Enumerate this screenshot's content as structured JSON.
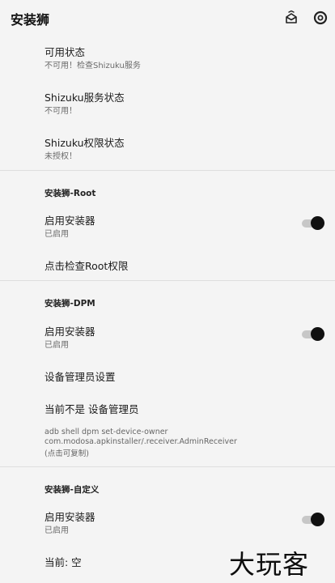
{
  "app": {
    "title": "安装狮"
  },
  "appbar": {
    "icons": [
      "package-icon",
      "settings-gear-icon"
    ]
  },
  "shizuku": {
    "available": {
      "title": "可用状态",
      "subtitle": "不可用！检查Shizuku服务"
    },
    "service": {
      "title": "Shizuku服务状态",
      "subtitle": "不可用！"
    },
    "permission": {
      "title": "Shizuku权限状态",
      "subtitle": "未授权！"
    }
  },
  "root": {
    "section": "安装狮-Root",
    "enable": {
      "title": "启用安装器",
      "subtitle": "已启用",
      "on": true
    },
    "check": {
      "title": "点击检查Root权限"
    }
  },
  "dpm": {
    "section": "安装狮-DPM",
    "enable": {
      "title": "启用安装器",
      "subtitle": "已启用",
      "on": true
    },
    "admin_settings": {
      "title": "设备管理员设置"
    },
    "status": {
      "title": "当前不是 设备管理员"
    },
    "command": {
      "line1": "adb shell dpm set-device-owner",
      "line2": "com.modosa.apkinstaller/.receiver.AdminReceiver",
      "line3": "(点击可复制)"
    }
  },
  "custom": {
    "section": "安装狮-自定义",
    "enable": {
      "title": "启用安装器",
      "subtitle": "已启用",
      "on": true
    },
    "current": {
      "title": "当前: 空"
    }
  },
  "watermark": "大玩客",
  "colors": {
    "background": "#f4f4f4",
    "switch_thumb": "#111111",
    "switch_track": "#c7c7c7"
  }
}
